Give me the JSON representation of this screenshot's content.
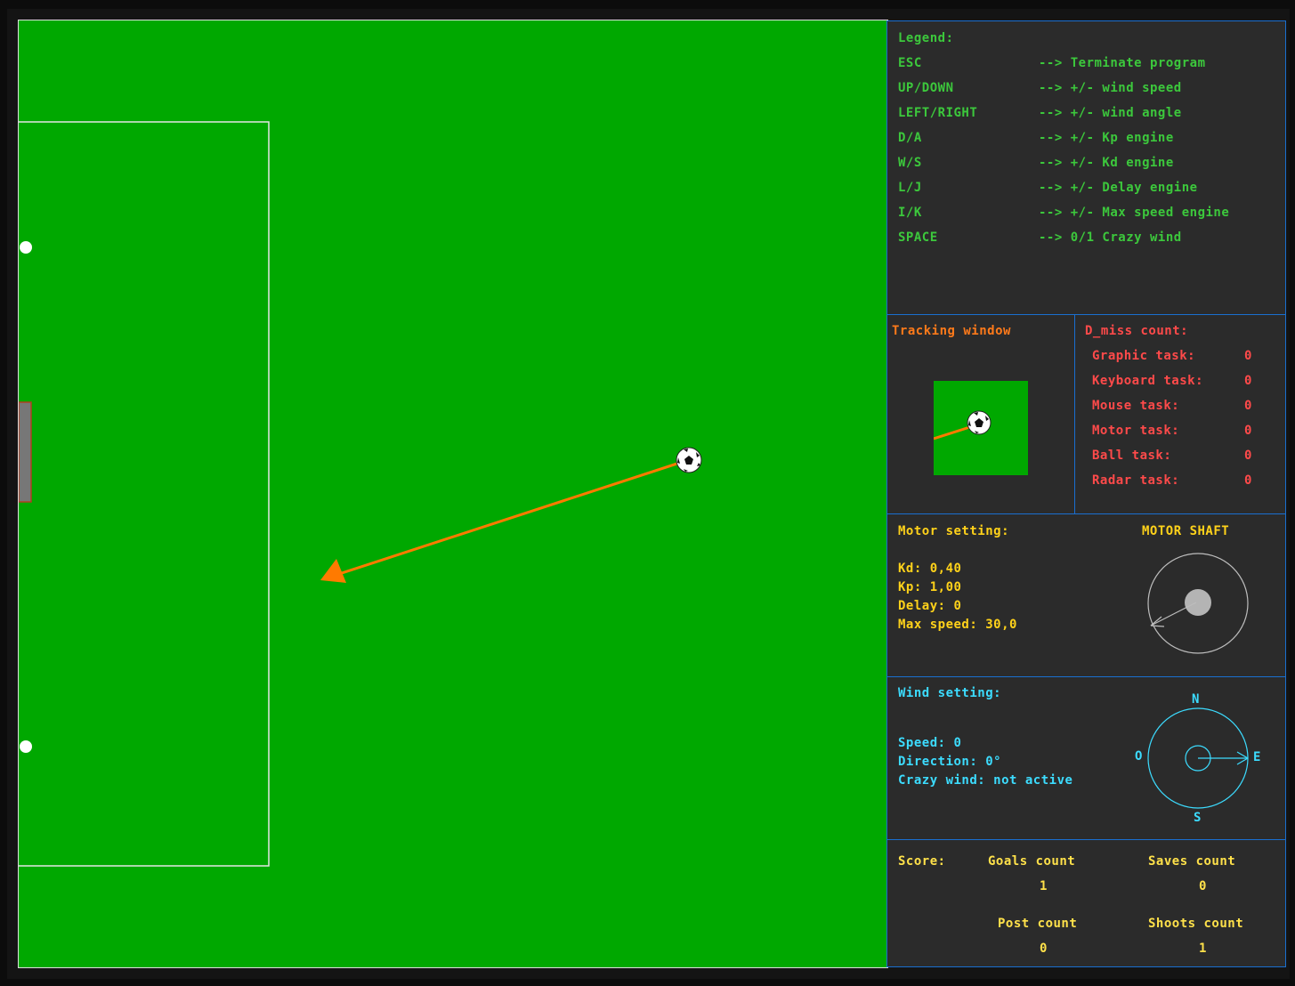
{
  "legend": {
    "title": "Legend:",
    "rows": [
      {
        "key": "ESC",
        "action": "--> Terminate program"
      },
      {
        "key": "UP/DOWN",
        "action": "--> +/- wind speed"
      },
      {
        "key": "LEFT/RIGHT",
        "action": "--> +/- wind angle"
      },
      {
        "key": "D/A",
        "action": "--> +/- Kp engine"
      },
      {
        "key": "W/S",
        "action": "--> +/- Kd engine"
      },
      {
        "key": "L/J",
        "action": "--> +/- Delay engine"
      },
      {
        "key": "I/K",
        "action": "--> +/- Max speed engine"
      },
      {
        "key": "SPACE",
        "action": "--> 0/1 Crazy wind"
      }
    ]
  },
  "tracking": {
    "title": "Tracking window"
  },
  "dmiss": {
    "title": "D_miss count:",
    "rows": [
      {
        "label": "Graphic task:",
        "value": "0"
      },
      {
        "label": "Keyboard task:",
        "value": "0"
      },
      {
        "label": "Mouse task:",
        "value": "0"
      },
      {
        "label": "Motor task:",
        "value": "0"
      },
      {
        "label": "Ball task:",
        "value": "0"
      },
      {
        "label": "Radar task:",
        "value": "0"
      }
    ]
  },
  "motor": {
    "title": "Motor setting:",
    "shaft_title": "MOTOR SHAFT",
    "kd": "Kd: 0,40",
    "kp": "Kp: 1,00",
    "delay": "Delay: 0",
    "max_speed": "Max speed: 30,0"
  },
  "wind": {
    "title": "Wind setting:",
    "speed": "Speed: 0",
    "direction": "Direction: 0°",
    "crazy": "Crazy wind: not active",
    "compass": {
      "n": "N",
      "s": "S",
      "e": "E",
      "w": "O"
    }
  },
  "score": {
    "title": "Score:",
    "goals_label": "Goals count",
    "goals_value": "1",
    "saves_label": "Saves count",
    "saves_value": "0",
    "post_label": "Post count",
    "post_value": "0",
    "shoots_label": "Shoots count",
    "shoots_value": "1"
  },
  "colors": {
    "field": "#00a800",
    "panel": "#2b2b2b",
    "panel_border": "#1a6fd0",
    "trajectory": "#ff7a00",
    "goal": "#7a7a7a"
  },
  "icons": {
    "ball": "soccer-ball-icon",
    "arrow": "arrow-head-icon"
  }
}
